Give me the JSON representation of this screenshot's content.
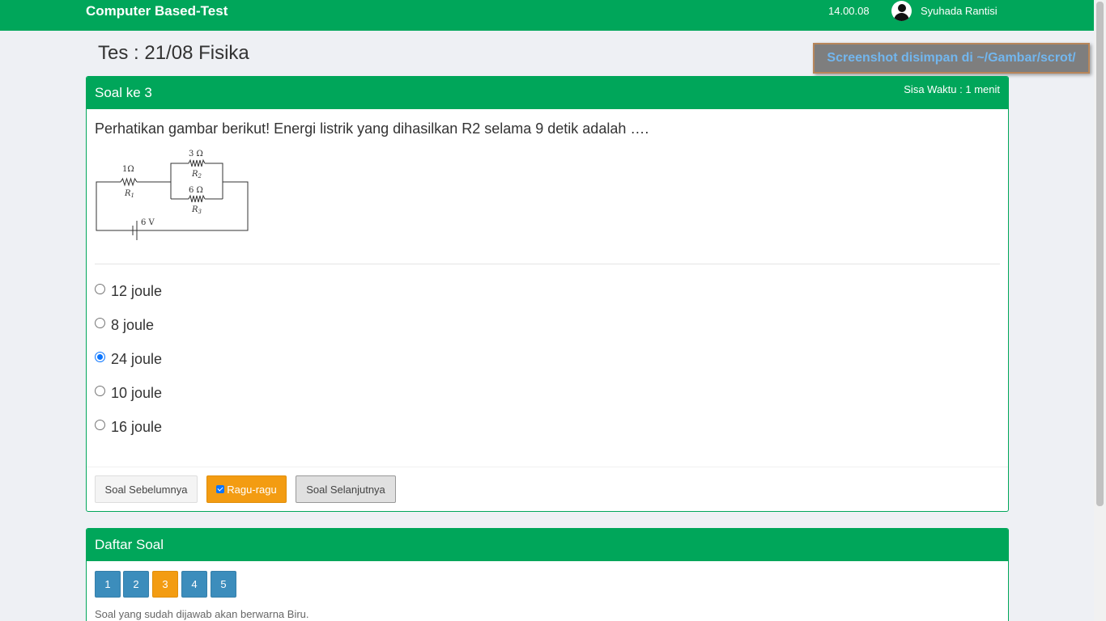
{
  "topbar": {
    "brand": "Computer Based-Test",
    "clock": "14.00.08",
    "username": "Syuhada Rantisi"
  },
  "page": {
    "title": "Tes : 21/08 Fisika"
  },
  "toast": {
    "text": "Screenshot disimpan di ~/Gambar/scrot/"
  },
  "question_panel": {
    "title": "Soal ke 3",
    "timer": "Sisa Waktu : 1 menit",
    "question": "Perhatikan gambar berikut! Energi listrik yang dihasilkan R2 selama 9 detik adalah ….",
    "circuit": {
      "r1_value": "1Ω",
      "r1_label": "R",
      "r1_sub": "1",
      "r2_value": "3 Ω",
      "r2_label": "R",
      "r2_sub": "2",
      "r3_value": "6 Ω",
      "r3_label": "R",
      "r3_sub": "3",
      "battery": "6 V"
    },
    "options": [
      {
        "label": "12 joule",
        "checked": false
      },
      {
        "label": "8 joule",
        "checked": false
      },
      {
        "label": "24 joule",
        "checked": true
      },
      {
        "label": "10 joule",
        "checked": false
      },
      {
        "label": "16 joule",
        "checked": false
      }
    ],
    "buttons": {
      "prev": "Soal Sebelumnya",
      "doubt": "Ragu-ragu",
      "next": "Soal Selanjutnya"
    }
  },
  "list_panel": {
    "title": "Daftar Soal",
    "numbers": [
      "1",
      "2",
      "3",
      "4",
      "5"
    ],
    "current": "3",
    "hint": "Soal yang sudah dijawab akan berwarna Biru."
  },
  "colors": {
    "primary_green": "#00a65a",
    "answered_blue": "#3c8dbc",
    "doubt_orange": "#f39c12"
  }
}
